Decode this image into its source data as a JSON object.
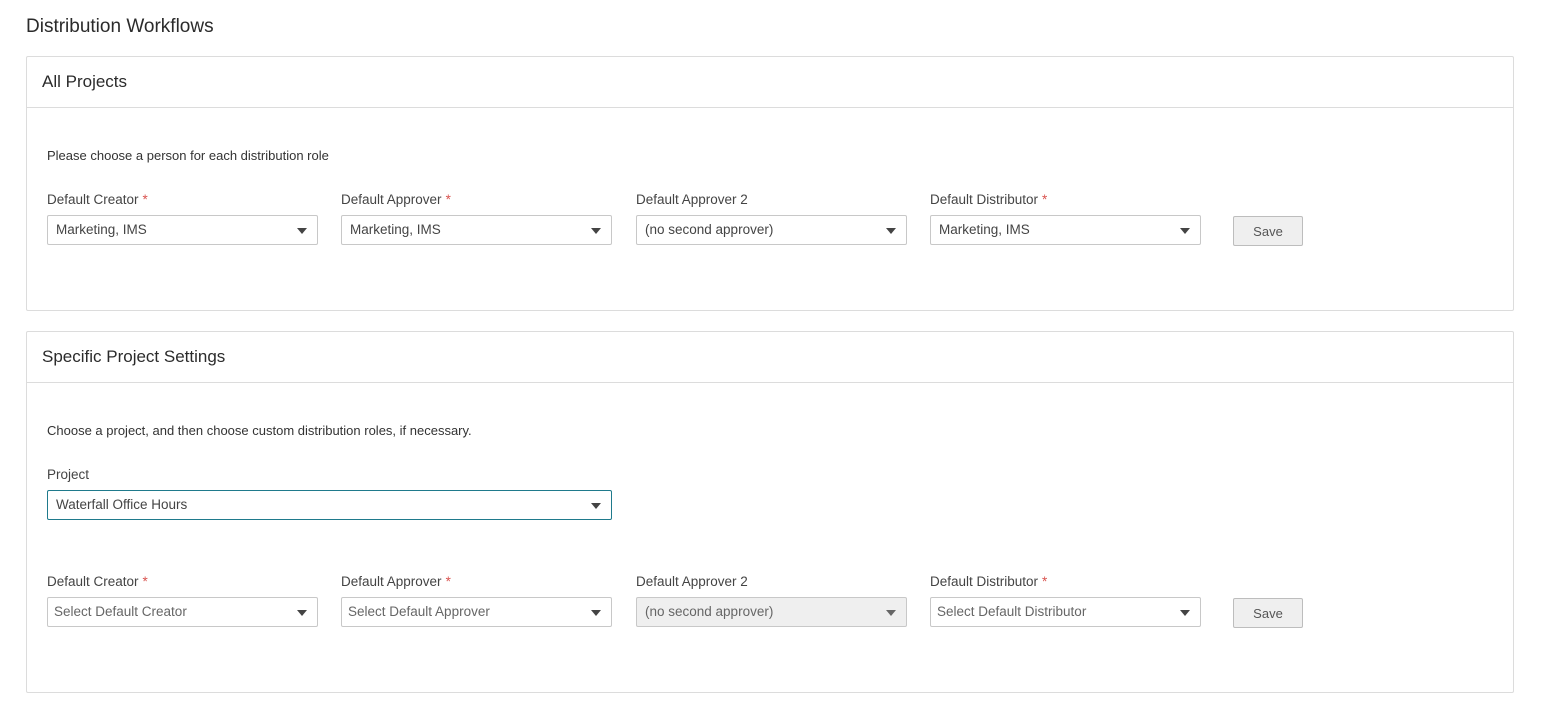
{
  "page": {
    "title": "Distribution Workflows"
  },
  "all_projects": {
    "header": "All Projects",
    "instruction": "Please choose a person for each distribution role",
    "fields": [
      {
        "label": "Default Creator",
        "required": "*",
        "value": "Marketing, IMS"
      },
      {
        "label": "Default Approver",
        "required": "*",
        "value": "Marketing, IMS"
      },
      {
        "label": "Default Approver 2",
        "required": "",
        "value": "(no second approver)"
      },
      {
        "label": "Default Distributor",
        "required": "*",
        "value": "Marketing, IMS"
      }
    ],
    "save_label": "Save"
  },
  "specific_projects": {
    "header": "Specific Project Settings",
    "instruction": "Choose a project, and then choose custom distribution roles, if necessary.",
    "project_label": "Project",
    "project_value": "Waterfall Office Hours",
    "fields": [
      {
        "label": "Default Creator",
        "required": "*",
        "placeholder": "Select Default Creator"
      },
      {
        "label": "Default Approver",
        "required": "*",
        "placeholder": "Select Default Approver"
      },
      {
        "label": "Default Approver 2",
        "required": "",
        "value": "(no second approver)",
        "disabled": true
      },
      {
        "label": "Default Distributor",
        "required": "*",
        "placeholder": "Select Default Distributor"
      }
    ],
    "save_label": "Save"
  },
  "colors": {
    "required_marker": "#d9534f",
    "focus_border": "#1f7a8c",
    "panel_border": "#dcdcdc"
  },
  "icons": {
    "dropdown": "caret-down-icon"
  }
}
